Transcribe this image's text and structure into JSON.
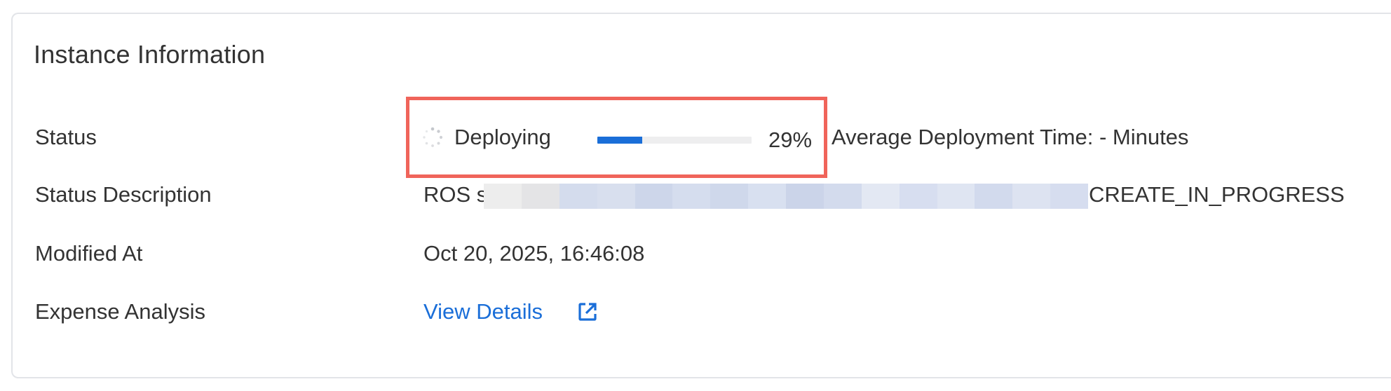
{
  "panel": {
    "title": "Instance Information"
  },
  "rows": {
    "status": {
      "label": "Status",
      "state": "Deploying",
      "progress_percent_text": "29%",
      "progress_fraction": 0.29,
      "avg_time": "Average Deployment Time: - Minutes"
    },
    "status_description": {
      "label": "Status Description",
      "prefix": "ROS s",
      "suffix": "CREATE_IN_PROGRESS"
    },
    "modified_at": {
      "label": "Modified At",
      "value": "Oct 20, 2025, 16:46:08"
    },
    "expense_analysis": {
      "label": "Expense Analysis",
      "link_text": "View Details",
      "icon": "external-link-icon"
    }
  },
  "colors": {
    "link": "#1a6ed8",
    "progress_fill": "#1a6ed8",
    "progress_track": "#eeeeef",
    "highlight_border": "#f0645a",
    "text": "#333333",
    "card_border": "#e2e4e8"
  }
}
